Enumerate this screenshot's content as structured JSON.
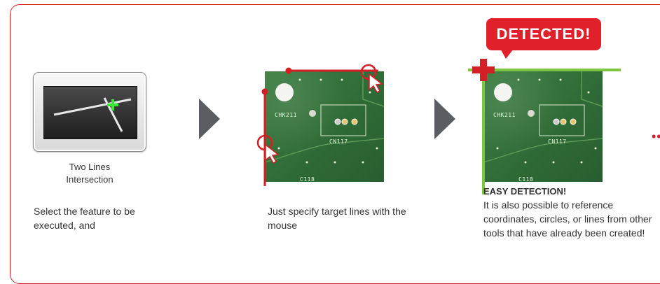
{
  "steps": [
    {
      "feature_label": "Two Lines Intersection",
      "description": "Select the feature to be executed, and"
    },
    {
      "description": "Just specify target lines with the mouse"
    },
    {
      "badge": "DETECTED!",
      "heading": "EASY DETECTION!",
      "description": "It is also possible to reference coordinates, circles, or lines from other tools that have already been created!"
    }
  ],
  "pcb": {
    "component_labels": [
      "CHK211",
      "CN117",
      "C118"
    ]
  },
  "colors": {
    "frame": "#d41f26",
    "badge": "#e0212a",
    "marker_red": "#d41f26",
    "detected_line": "#7cc63e",
    "arrow": "#5a5e63",
    "crosshair_green": "#39e639"
  },
  "icons": [
    "two-lines-intersection-icon",
    "mouse-cursor-icon",
    "next-arrow-icon",
    "crosshair-icon"
  ]
}
